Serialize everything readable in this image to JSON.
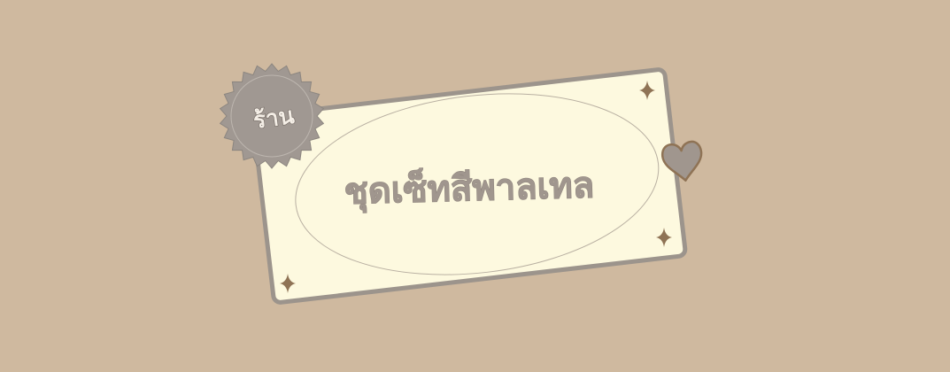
{
  "badge": {
    "label": "ร้าน"
  },
  "card": {
    "title": "ชุดเซ็ทสีพาลเทล"
  },
  "colors": {
    "background": "#CFB99F",
    "card_fill": "#FDF9DF",
    "card_border": "#9C948C",
    "badge_fill": "#A09892",
    "title_fill": "#A0968E",
    "sparkle": "#8F7355",
    "heart_fill": "#A0968E",
    "heart_stroke": "#8F7355"
  },
  "decorations": {
    "sparkle_icon": "four-point-star-icon",
    "heart_icon": "heart-icon",
    "badge_shape": "sunburst-badge"
  }
}
